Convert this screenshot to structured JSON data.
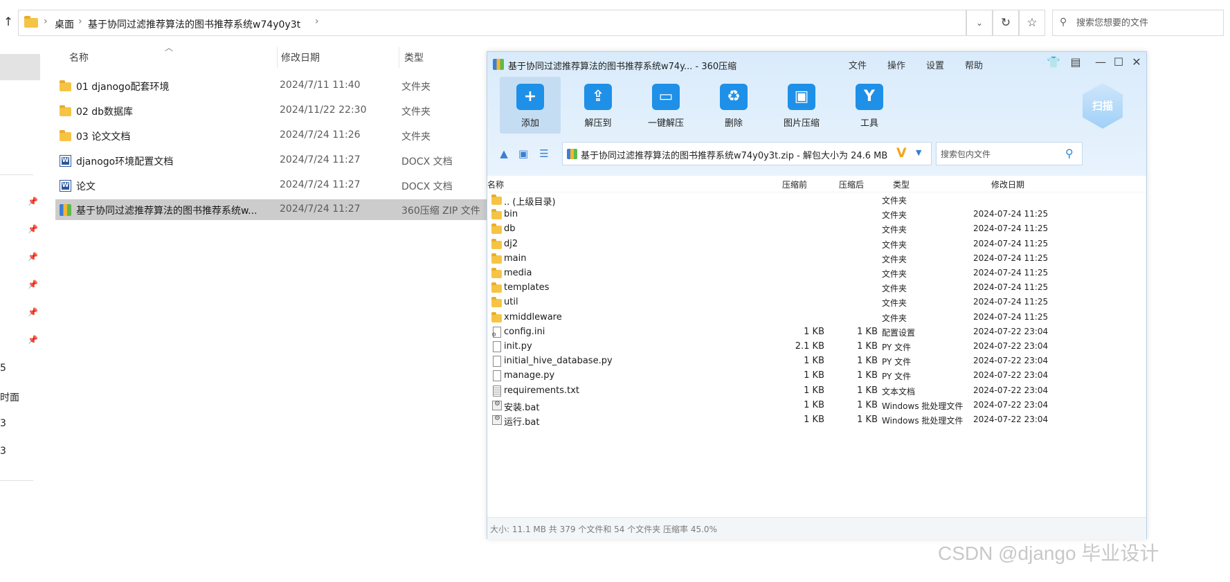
{
  "explorer": {
    "breadcrumb": [
      "桌面",
      "基于协同过滤推荐算法的图书推荐系统w74y0y3t"
    ],
    "search_placeholder": "搜索您想要的文件",
    "columns": {
      "name": "名称",
      "date": "修改日期",
      "type": "类型"
    },
    "files": [
      {
        "name": "01 djanogo配套环境",
        "date": "2024/7/11 11:40",
        "type": "文件夹",
        "icon": "folder-icon"
      },
      {
        "name": "02 db数据库",
        "date": "2024/11/22 22:30",
        "type": "文件夹",
        "icon": "folder-icon"
      },
      {
        "name": "03 论文文档",
        "date": "2024/7/24 11:26",
        "type": "文件夹",
        "icon": "folder-icon"
      },
      {
        "name": "djanogo环境配置文档",
        "date": "2024/7/24 11:27",
        "type": "DOCX 文档",
        "icon": "word-doc-icon"
      },
      {
        "name": "论文",
        "date": "2024/7/24 11:27",
        "type": "DOCX 文档",
        "icon": "word-doc-icon"
      },
      {
        "name": "基于协同过滤推荐算法的图书推荐系统w...",
        "date": "2024/7/24 11:27",
        "type": "360压缩 ZIP 文件",
        "icon": "zip-archive-icon"
      }
    ],
    "nav_partial_labels": [
      "5",
      "时面",
      "3",
      "3"
    ]
  },
  "zip_window": {
    "title": "基于协同过滤推荐算法的图书推荐系统w74y... - 360压缩",
    "menu": [
      "文件",
      "操作",
      "设置",
      "帮助"
    ],
    "tools": [
      {
        "label": "添加",
        "glyph": "+"
      },
      {
        "label": "解压到",
        "glyph": "⇪"
      },
      {
        "label": "一键解压",
        "glyph": "▭"
      },
      {
        "label": "删除",
        "glyph": "♻"
      },
      {
        "label": "图片压缩",
        "glyph": "▣"
      },
      {
        "label": "工具",
        "glyph": "Y"
      }
    ],
    "scan_label": "扫描",
    "path_text": "基于协同过滤推荐算法的图书推荐系统w74y0y3t.zip - 解包大小为 24.6 MB",
    "search_placeholder": "搜索包内文件",
    "columns": {
      "name": "名称",
      "packed": "压缩前",
      "compressed": "压缩后",
      "type": "类型",
      "modified": "修改日期"
    },
    "entries": [
      {
        "name": ".. (上级目录)",
        "packed": "",
        "compressed": "",
        "type": "文件夹",
        "modified": "",
        "icon": "folder"
      },
      {
        "name": "bin",
        "packed": "",
        "compressed": "",
        "type": "文件夹",
        "modified": "2024-07-24 11:25",
        "icon": "folder"
      },
      {
        "name": "db",
        "packed": "",
        "compressed": "",
        "type": "文件夹",
        "modified": "2024-07-24 11:25",
        "icon": "folder"
      },
      {
        "name": "dj2",
        "packed": "",
        "compressed": "",
        "type": "文件夹",
        "modified": "2024-07-24 11:25",
        "icon": "folder"
      },
      {
        "name": "main",
        "packed": "",
        "compressed": "",
        "type": "文件夹",
        "modified": "2024-07-24 11:25",
        "icon": "folder"
      },
      {
        "name": "media",
        "packed": "",
        "compressed": "",
        "type": "文件夹",
        "modified": "2024-07-24 11:25",
        "icon": "folder"
      },
      {
        "name": "templates",
        "packed": "",
        "compressed": "",
        "type": "文件夹",
        "modified": "2024-07-24 11:25",
        "icon": "folder"
      },
      {
        "name": "util",
        "packed": "",
        "compressed": "",
        "type": "文件夹",
        "modified": "2024-07-24 11:25",
        "icon": "folder"
      },
      {
        "name": "xmiddleware",
        "packed": "",
        "compressed": "",
        "type": "文件夹",
        "modified": "2024-07-24 11:25",
        "icon": "folder"
      },
      {
        "name": "config.ini",
        "packed": "1 KB",
        "compressed": "1 KB",
        "type": "配置设置",
        "modified": "2024-07-22 23:04",
        "icon": "ini"
      },
      {
        "name": "init.py",
        "packed": "2.1 KB",
        "compressed": "1 KB",
        "type": "PY 文件",
        "modified": "2024-07-22 23:04",
        "icon": "file"
      },
      {
        "name": "initial_hive_database.py",
        "packed": "1 KB",
        "compressed": "1 KB",
        "type": "PY 文件",
        "modified": "2024-07-22 23:04",
        "icon": "file"
      },
      {
        "name": "manage.py",
        "packed": "1 KB",
        "compressed": "1 KB",
        "type": "PY 文件",
        "modified": "2024-07-22 23:04",
        "icon": "file"
      },
      {
        "name": "requirements.txt",
        "packed": "1 KB",
        "compressed": "1 KB",
        "type": "文本文档",
        "modified": "2024-07-22 23:04",
        "icon": "txt"
      },
      {
        "name": "安装.bat",
        "packed": "1 KB",
        "compressed": "1 KB",
        "type": "Windows 批处理文件",
        "modified": "2024-07-22 23:04",
        "icon": "bat"
      },
      {
        "name": "运行.bat",
        "packed": "1 KB",
        "compressed": "1 KB",
        "type": "Windows 批处理文件",
        "modified": "2024-07-22 23:04",
        "icon": "bat"
      }
    ],
    "status": "大小: 11.1 MB 共 379 个文件和 54 个文件夹 压缩率 45.0%"
  },
  "watermark": "CSDN @django  毕业设计"
}
